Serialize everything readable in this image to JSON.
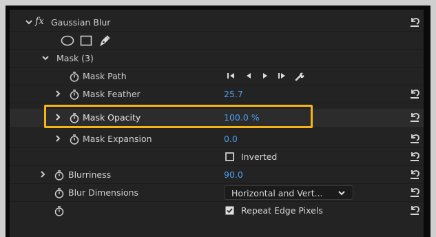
{
  "effect": {
    "name": "Gaussian Blur",
    "fx_label": "fx"
  },
  "mask_tools": [
    "ellipse-mask-icon",
    "rectangle-mask-icon",
    "pen-mask-icon"
  ],
  "mask_group": {
    "label": "Mask (3)"
  },
  "mask_path": {
    "label": "Mask Path",
    "controls": [
      "track-backward-one-icon",
      "track-backward-icon",
      "track-forward-icon",
      "track-forward-one-icon",
      "wrench-icon"
    ]
  },
  "mask_feather": {
    "label": "Mask Feather",
    "value": "25.7"
  },
  "mask_opacity": {
    "label": "Mask Opacity",
    "value": "100.0 %"
  },
  "mask_expansion": {
    "label": "Mask Expansion",
    "value": "0.0"
  },
  "inverted": {
    "label": "Inverted",
    "checked": false
  },
  "blurriness": {
    "label": "Blurriness",
    "value": "90.0"
  },
  "blur_dimensions": {
    "label": "Blur Dimensions",
    "selected": "Horizontal and Vert..."
  },
  "repeat_edge": {
    "label": "Repeat Edge Pixels",
    "checked": true
  },
  "colors": {
    "panel": "#232323",
    "value_blue": "#4a9ff5",
    "highlight": "#f5b615"
  }
}
